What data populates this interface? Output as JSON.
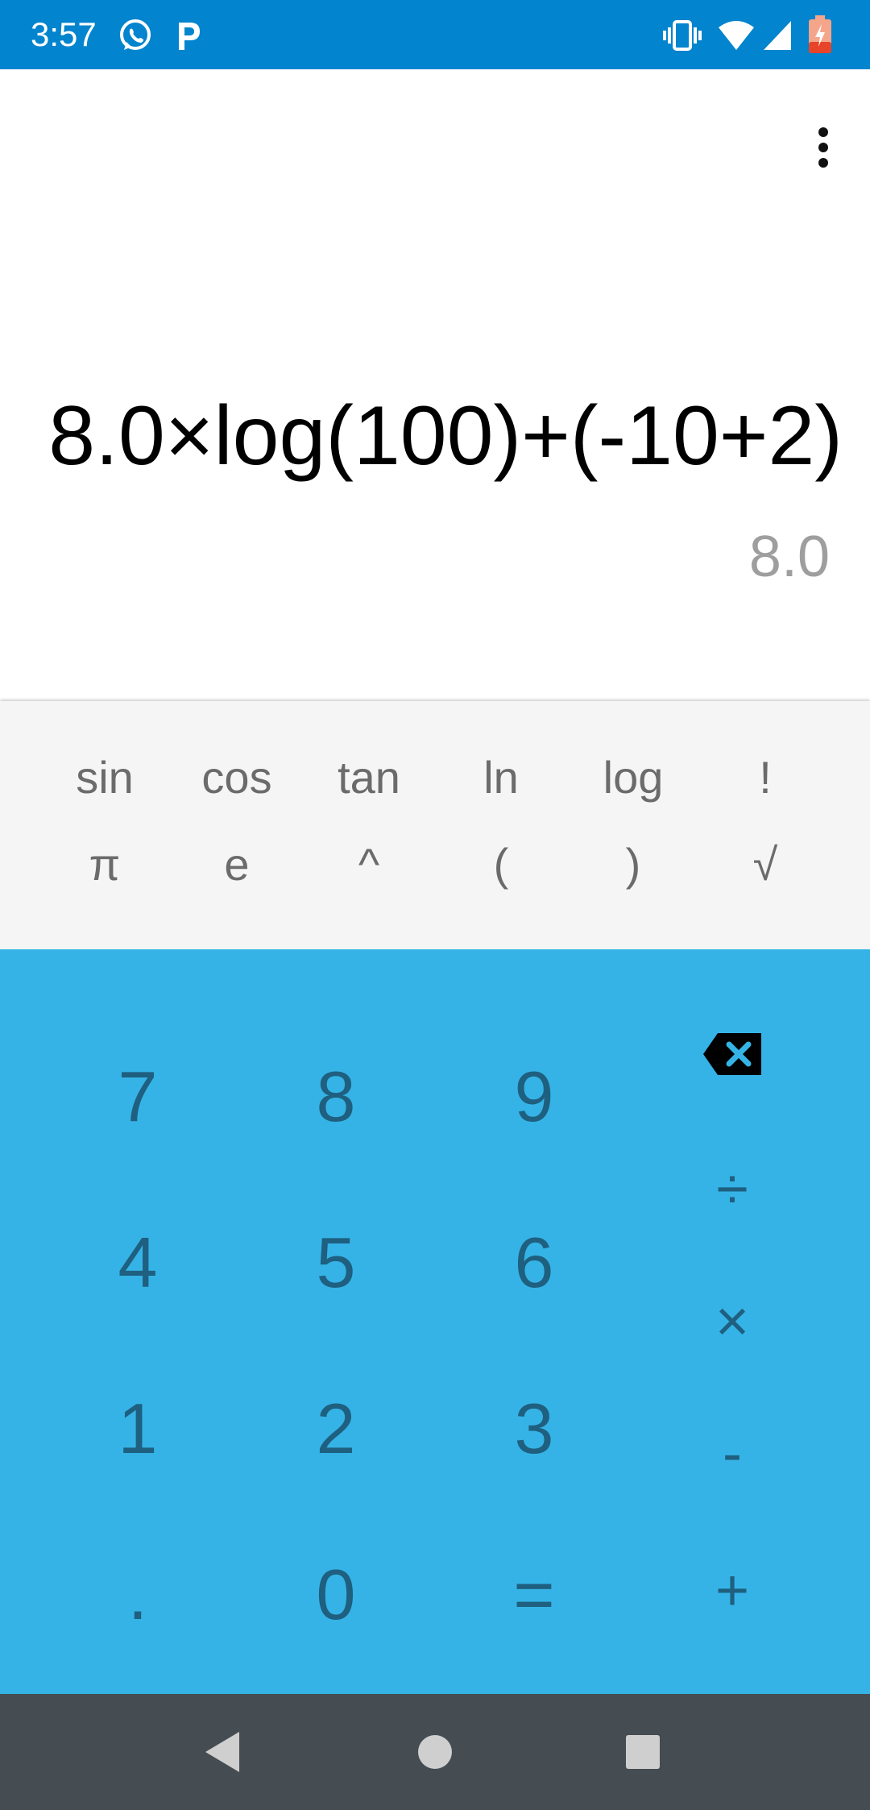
{
  "status_bar": {
    "time": "3:57",
    "left_icons": [
      "whatsapp-icon",
      "parking-app-icon"
    ],
    "right_icons": [
      "vibrate-icon",
      "wifi-icon",
      "cell-signal-icon",
      "battery-low-icon"
    ],
    "background_color": "#0284ce"
  },
  "display": {
    "menu_icon": "more-vert-icon",
    "expression": "8.0×log(100)+(-10+2)",
    "result": "8.0"
  },
  "scientific_keys": {
    "row1": [
      "sin",
      "cos",
      "tan",
      "ln",
      "log",
      "!"
    ],
    "row2": [
      "π",
      "e",
      "^",
      "(",
      ")",
      "√"
    ]
  },
  "keypad": {
    "digits": [
      "7",
      "8",
      "9",
      "4",
      "5",
      "6",
      "1",
      "2",
      "3",
      ".",
      "0",
      "="
    ],
    "operators": {
      "backspace": "backspace-icon",
      "divide": "÷",
      "multiply": "×",
      "subtract": "-",
      "add": "+"
    },
    "background_color": "#35b3e6"
  },
  "nav_bar": {
    "icons": [
      "back-icon",
      "home-icon",
      "recents-icon"
    ],
    "background_color": "#454c52"
  }
}
